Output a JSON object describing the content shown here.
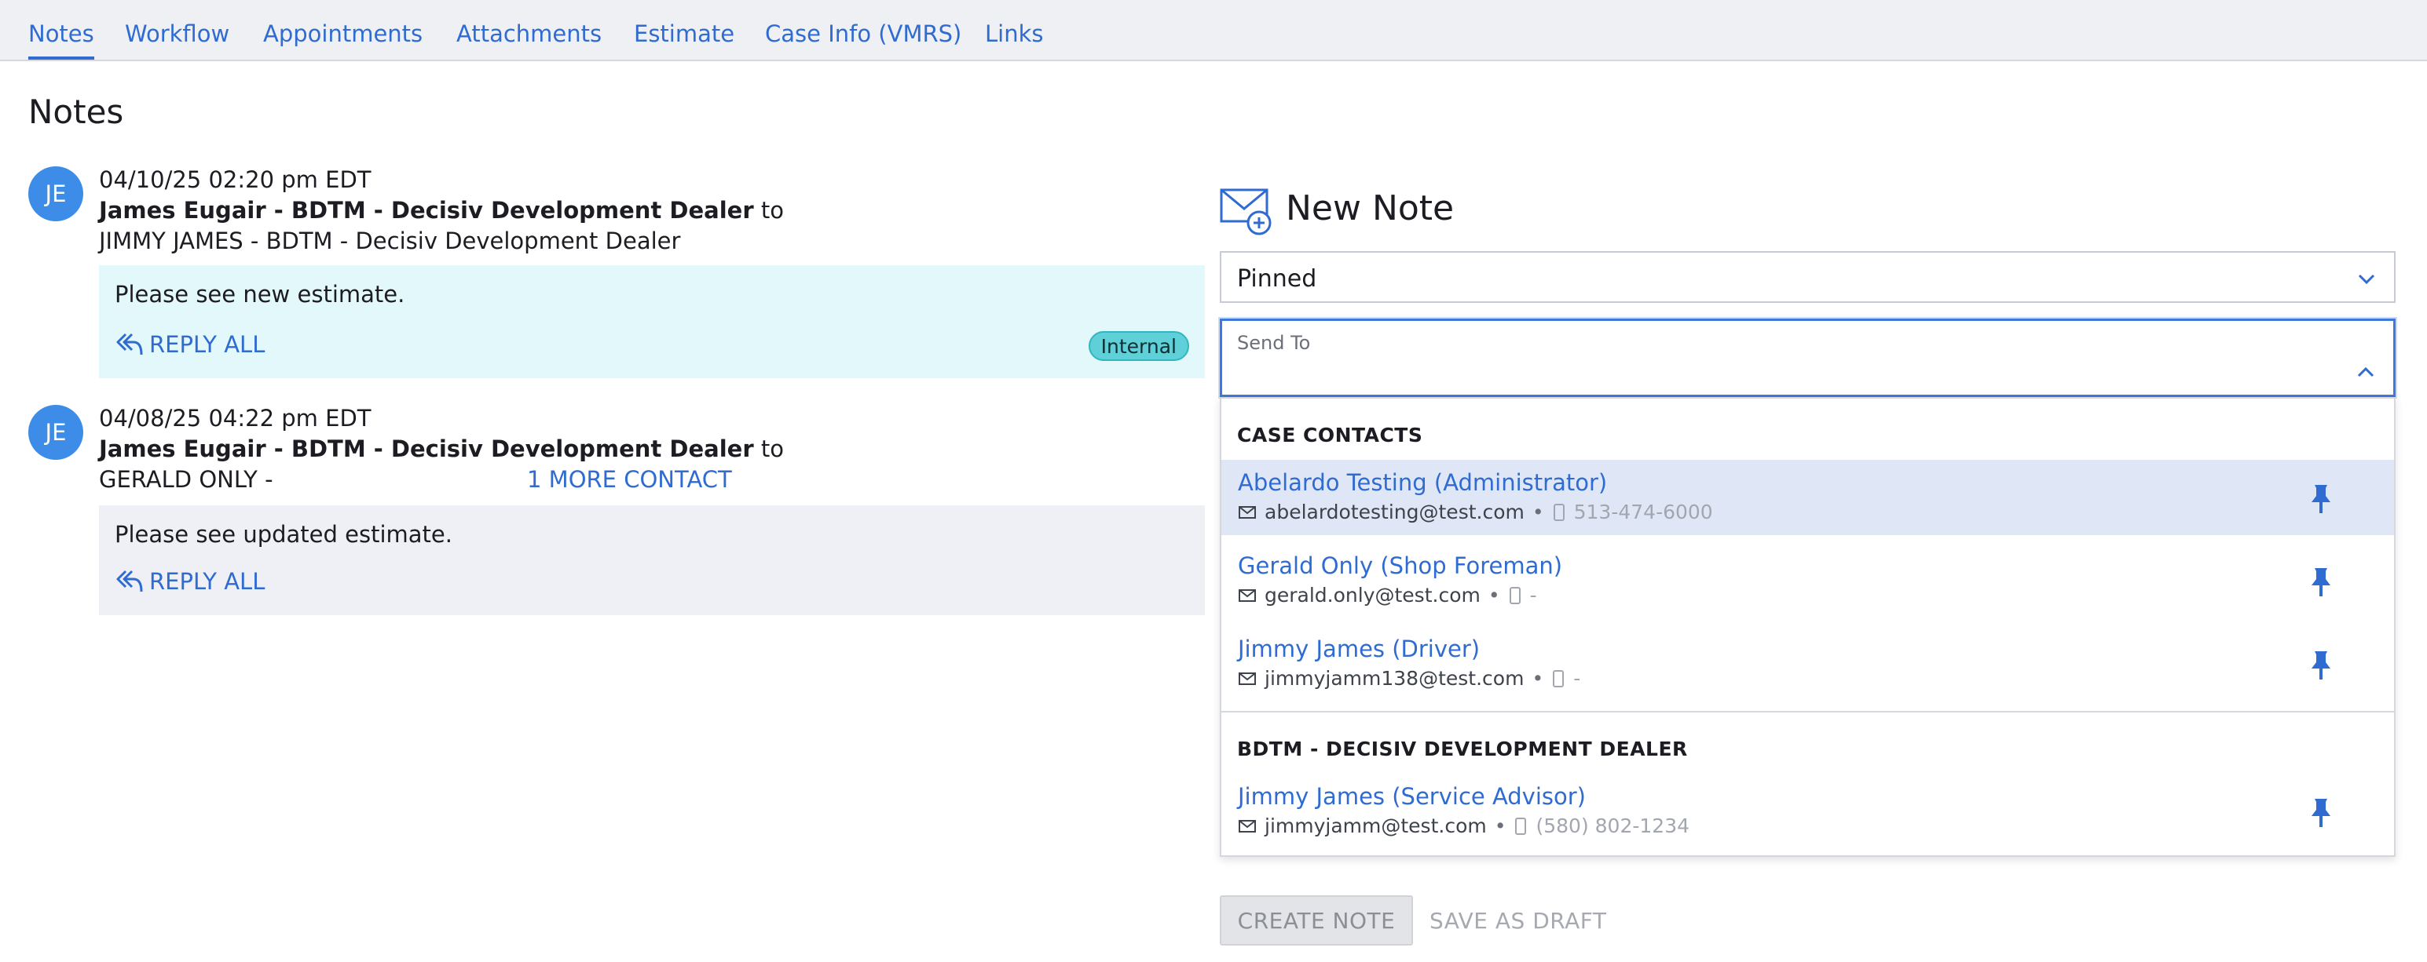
{
  "tabs": [
    {
      "label": "Notes",
      "active": true
    },
    {
      "label": "Workflow"
    },
    {
      "label": "Appointments"
    },
    {
      "label": "Attachments"
    },
    {
      "label": "Estimate"
    },
    {
      "label": "Case Info (VMRS)"
    },
    {
      "label": "Links"
    }
  ],
  "page": {
    "title": "Notes"
  },
  "notes": [
    {
      "initials": "JE",
      "timestamp": "04/10/25 02:20 pm EDT",
      "from": "James Eugair - BDTM - Decisiv Development Dealer",
      "to_word": "to",
      "recipients": "JIMMY JAMES - BDTM - Decisiv Development Dealer",
      "message": "Please see new estimate.",
      "reply_label": "REPLY ALL",
      "badge": "Internal"
    },
    {
      "initials": "JE",
      "timestamp": "04/08/25 04:22 pm EDT",
      "from": "James Eugair - BDTM - Decisiv Development Dealer",
      "to_word": "to",
      "recipients": "GERALD ONLY -",
      "more_contacts": "1 MORE CONTACT",
      "message": "Please see updated estimate.",
      "reply_label": "REPLY ALL"
    }
  ],
  "new_note": {
    "title": "New Note",
    "visibility_value": "Pinned",
    "send_to_label": "Send To",
    "groups": [
      {
        "header": "CASE CONTACTS",
        "contacts": [
          {
            "name": "Abelardo Testing",
            "role": "(Administrator)",
            "email": "abelardotesting@test.com",
            "phone": "513-474-6000",
            "highlighted": true
          },
          {
            "name": "Gerald Only",
            "role": "(Shop Foreman)",
            "email": "gerald.only@test.com",
            "phone": "-"
          },
          {
            "name": "Jimmy James",
            "role": "(Driver)",
            "email": "jimmyjamm138@test.com",
            "phone": "-"
          }
        ]
      },
      {
        "header": "BDTM - DECISIV DEVELOPMENT DEALER",
        "contacts": [
          {
            "name": "Jimmy James",
            "role": "(Service Advisor)",
            "email": "jimmyjamm@test.com",
            "phone": "(580) 802-1234"
          }
        ]
      }
    ],
    "dot": "•",
    "create_label": "CREATE NOTE",
    "draft_label": "SAVE AS DRAFT"
  },
  "colors": {
    "accent": "#2f6bd0",
    "avatar": "#3d8de8",
    "internal_note_bg": "#e3f8fa",
    "note_bg": "#eef0f5",
    "badge": "#5fd0d8",
    "highlight": "#dfe7f7"
  },
  "icons": {
    "new_note": "envelope-plus-icon",
    "reply": "reply-all-icon",
    "pin": "pin-icon",
    "mail": "mail-icon",
    "phone": "phone-icon",
    "chevron": "chevron-icon"
  }
}
